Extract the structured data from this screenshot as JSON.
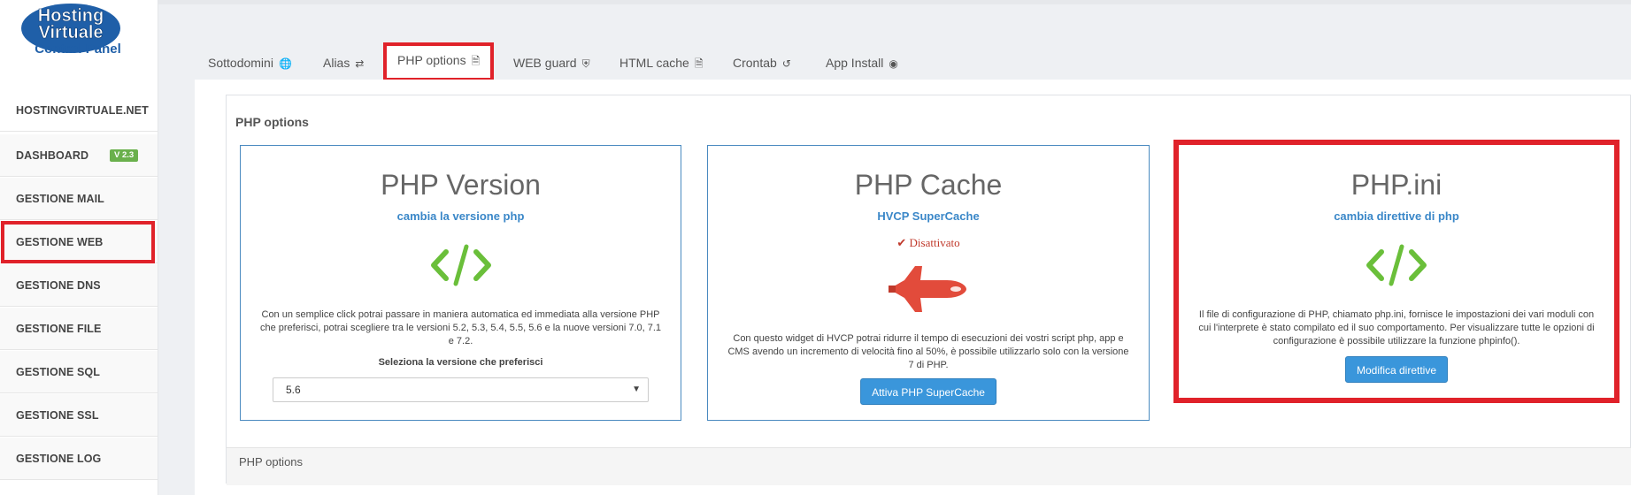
{
  "logo": {
    "line1": "Hosting",
    "line2": "Virtuale",
    "line3": "Control Panel"
  },
  "sidebar": {
    "brand": "HOSTINGVIRTUALE.NET",
    "items": [
      {
        "label": "DASHBOARD",
        "badge": "V 2.3"
      },
      {
        "label": "GESTIONE MAIL"
      },
      {
        "label": "GESTIONE WEB"
      },
      {
        "label": "GESTIONE DNS"
      },
      {
        "label": "GESTIONE FILE"
      },
      {
        "label": "GESTIONE SQL"
      },
      {
        "label": "GESTIONE SSL"
      },
      {
        "label": "GESTIONE LOG"
      }
    ]
  },
  "tabs": [
    {
      "label": "Sottodomini",
      "icon": "globe-icon"
    },
    {
      "label": "Alias",
      "icon": "shuffle-icon"
    },
    {
      "label": "PHP options",
      "icon": "code-file-icon"
    },
    {
      "label": "WEB guard",
      "icon": "shield-icon"
    },
    {
      "label": "HTML cache",
      "icon": "file-icon"
    },
    {
      "label": "Crontab",
      "icon": "history-icon"
    },
    {
      "label": "App Install",
      "icon": "wordpress-icon"
    }
  ],
  "panel": {
    "title": "PHP options",
    "footer": "PHP options",
    "cards": [
      {
        "title": "PHP Version",
        "subtitle": "cambia la versione php",
        "description": "Con un semplice click potrai passare in maniera automatica ed immediata alla versione PHP che preferisci, potrai scegliere tra le versioni 5.2, 5.3, 5.4, 5.5, 5.6 e la nuove versioni 7.0, 7.1 e 7.2.",
        "select_label": "Seleziona la versione che preferisci",
        "select_value": "5.6"
      },
      {
        "title": "PHP Cache",
        "subtitle": "HVCP SuperCache",
        "status": "Disattivato",
        "description": "Con questo widget di HVCP potrai ridurre il tempo di esecuzioni dei vostri script php, app e CMS avendo un incremento di velocità fino al 50%, è possibile utilizzarlo solo con la versione 7 di PHP.",
        "button": "Attiva PHP SuperCache"
      },
      {
        "title": "PHP.ini",
        "subtitle": "cambia direttive di php",
        "description": "Il file di configurazione di PHP, chiamato php.ini, fornisce le impostazioni dei vari moduli con cui l'interprete è stato compilato ed il suo comportamento. Per visualizzare tutte le opzioni di configurazione è possibile utilizzare la funzione phpinfo().",
        "button": "Modifica direttive"
      }
    ]
  },
  "colors": {
    "accent": "#3a96db",
    "highlight": "#e0222a",
    "code_icon": "#6abf3a",
    "status": "#c0392b"
  }
}
